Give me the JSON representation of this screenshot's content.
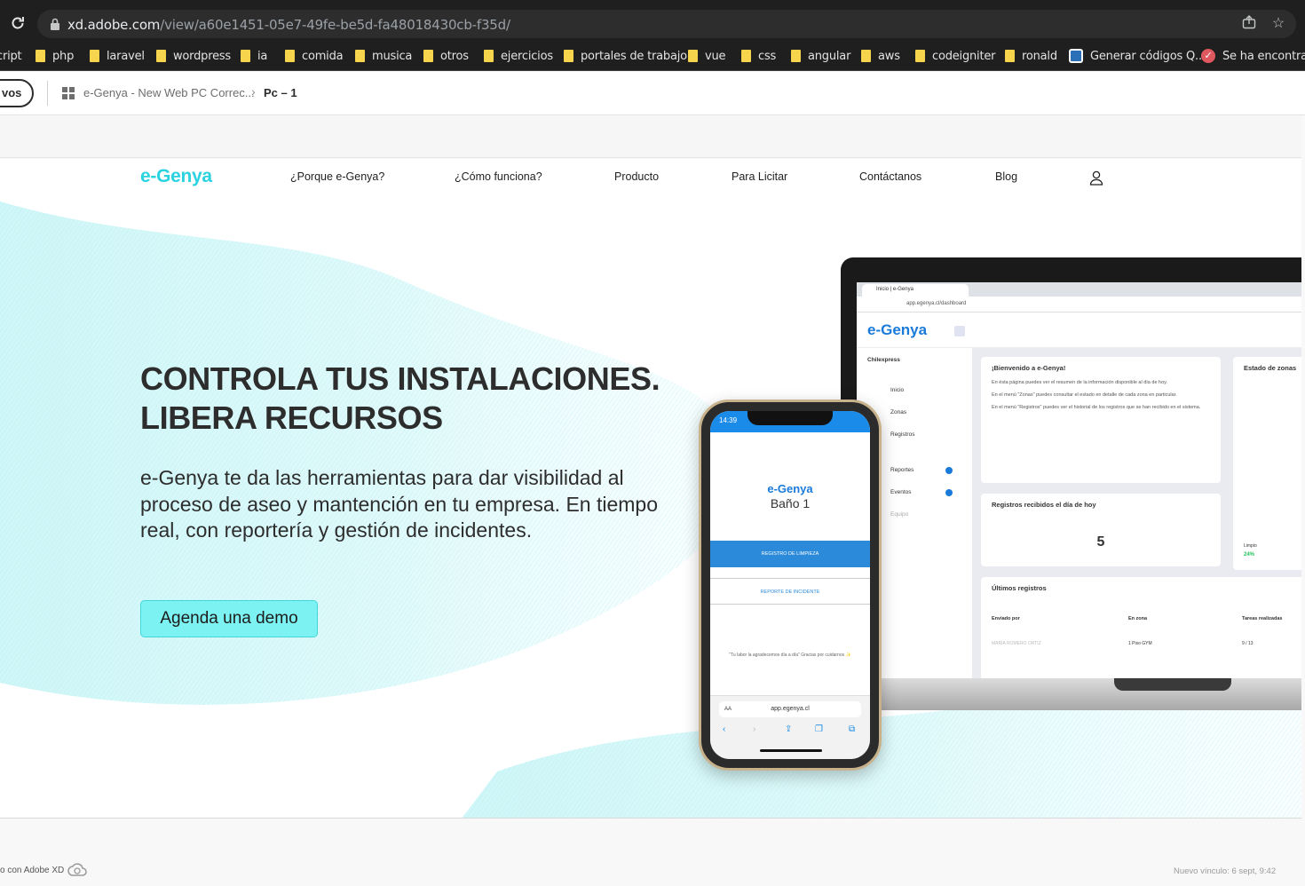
{
  "browser": {
    "url_host": "xd.adobe.com",
    "url_path": "/view/a60e1451-05e7-49fe-be5d-fa48018430cb-f35d/",
    "bookmarks": [
      {
        "label": "cript",
        "icon": "folder-icon"
      },
      {
        "label": "php",
        "icon": "folder-icon"
      },
      {
        "label": "laravel",
        "icon": "folder-icon"
      },
      {
        "label": "wordpress",
        "icon": "folder-icon"
      },
      {
        "label": "ia",
        "icon": "folder-icon"
      },
      {
        "label": "comida",
        "icon": "folder-icon"
      },
      {
        "label": "musica",
        "icon": "folder-icon"
      },
      {
        "label": "otros",
        "icon": "folder-icon"
      },
      {
        "label": "ejercicios",
        "icon": "folder-icon"
      },
      {
        "label": "portales de trabajo",
        "icon": "folder-icon"
      },
      {
        "label": "vue",
        "icon": "folder-icon"
      },
      {
        "label": "css",
        "icon": "folder-icon"
      },
      {
        "label": "angular",
        "icon": "folder-icon"
      },
      {
        "label": "aws",
        "icon": "folder-icon"
      },
      {
        "label": "codeigniter",
        "icon": "folder-icon"
      },
      {
        "label": "ronald",
        "icon": "folder-icon"
      },
      {
        "label": "Generar códigos Q...",
        "icon": "qr-icon"
      },
      {
        "label": "Se ha encontrado",
        "icon": "check-badge-icon"
      }
    ]
  },
  "xd": {
    "left_button": "vos",
    "breadcrumb_doc": "e-Genya - New Web PC Correc...",
    "breadcrumb_artboard": "Pc – 1",
    "footer_left": "o con Adobe XD",
    "footer_right": "Nuevo vínculo: 6 sept, 9:42"
  },
  "site": {
    "logo": "e-Genya",
    "nav": [
      "¿Porque e-Genya?",
      "¿Cómo funciona?",
      "Producto",
      "Para Licitar",
      "Contáctanos",
      "Blog"
    ],
    "headline_line1": "CONTROLA TUS INSTALACIONES.",
    "headline_line2": "LIBERA RECURSOS",
    "lead": "e-Genya te da las herramientas para dar visibilidad al proceso de aseo y mantención en tu empresa. En tiempo real, con reportería y gestión de incidentes.",
    "cta": "Agenda una demo",
    "accent_color": "#2bd2e0",
    "cta_color": "#7cf3f2"
  },
  "laptop": {
    "tab_title": "Inicio | e-Genya",
    "address": "app.egenya.cl/dashboard",
    "app_logo": "e-Genya",
    "org": "Chilexpress",
    "menu": [
      "Inicio",
      "Zonas",
      "Registros",
      "Reportes",
      "Eventos",
      "Equipo"
    ],
    "welcome_title": "¡Bienvenido a e-Genya!",
    "welcome_p1": "En ésta página puedes ver el resumen de la información disponible al día de hoy.",
    "welcome_p2": "En el menú \"Zonas\" puedes consultar el estado en detalle de cada zona en particular.",
    "welcome_p3": "En el menú \"Registros\" puedes ver el historial de los registros que se han recibido en el sistema.",
    "zones_title": "Estado de zonas",
    "records_title": "Registros recibidos el día de hoy",
    "records_value": "5",
    "clean_label": "Limpio",
    "clean_pct": "24%",
    "last_title": "Últimos registros",
    "col_sent": "Enviado por",
    "col_zone": "En zona",
    "col_tasks": "Tareas realizadas",
    "row_name": "MARIA ROMERO ORTIZ",
    "row_zone": "1 Piso GYM",
    "row_tasks": "9 / 13"
  },
  "phone": {
    "time": "14:39",
    "brand": "e-Genya",
    "location": "Baño 1",
    "btn_clean": "REGISTRO DE LIMPIEZA",
    "btn_incident": "REPORTE DE INCIDENTE",
    "quote": "\"Tu labor la agradecemos día a día\" Gracias por cuidarnos ✨",
    "font_size_label": "AA",
    "url": "app.egenya.cl"
  }
}
